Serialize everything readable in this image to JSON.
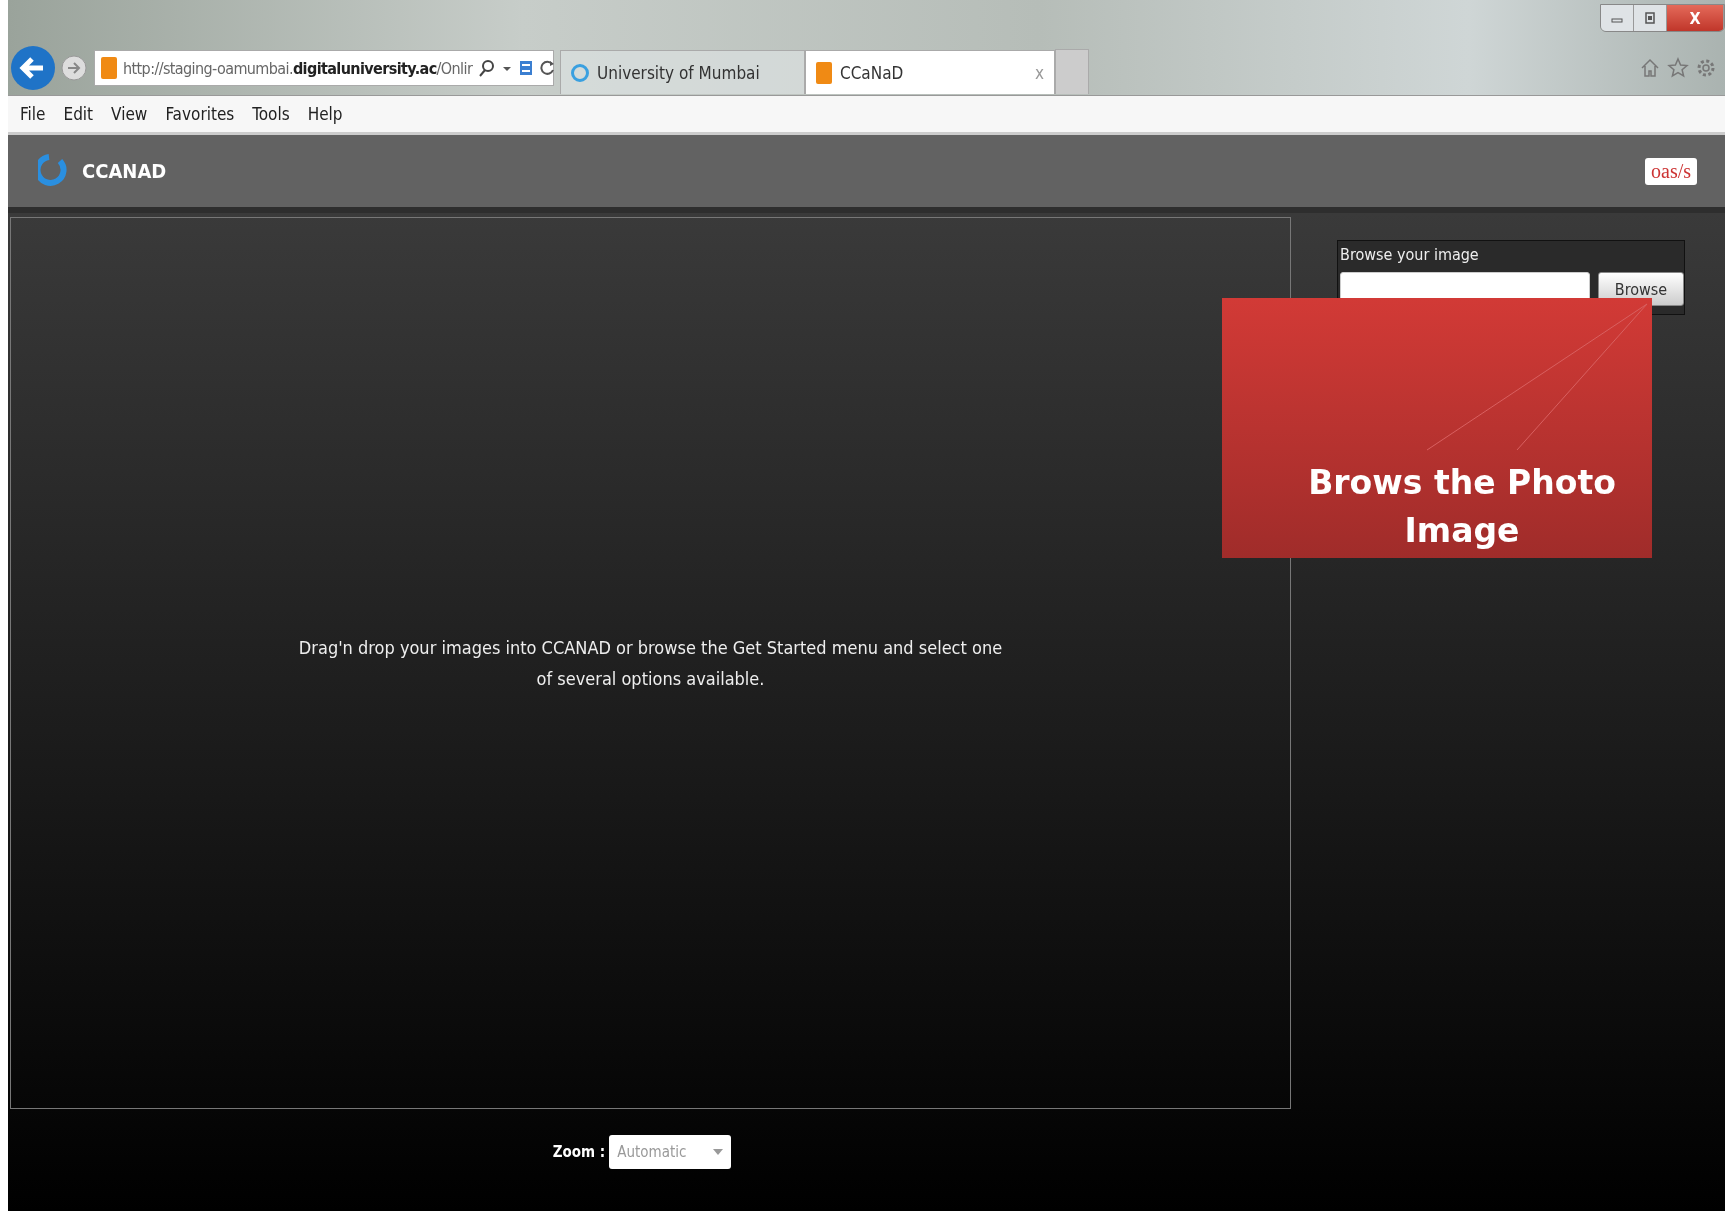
{
  "browser": {
    "address": "http://staging-oamumbai.**digitaluniversity.ac**/Onlir",
    "tabs": [
      {
        "label": "University of Mumbai",
        "selected": false,
        "kind": "ie"
      },
      {
        "label": "CCaNaD",
        "selected": true,
        "kind": "site",
        "close": "x"
      }
    ],
    "window_close": "X",
    "menu": [
      "File",
      "Edit",
      "View",
      "Favorites",
      "Tools",
      "Help"
    ]
  },
  "app": {
    "title": "CCANAD",
    "partner_logo": "oas/s"
  },
  "drop_zone": {
    "message": "Drag'n drop your images into CCANAD or browse the Get Started menu and select one of several options available."
  },
  "browse_panel": {
    "title": "Browse your image",
    "button": "Browse"
  },
  "callout": {
    "text": "Brows the Photo Image"
  },
  "zoom": {
    "label": "Zoom :",
    "value": "Automatic"
  }
}
